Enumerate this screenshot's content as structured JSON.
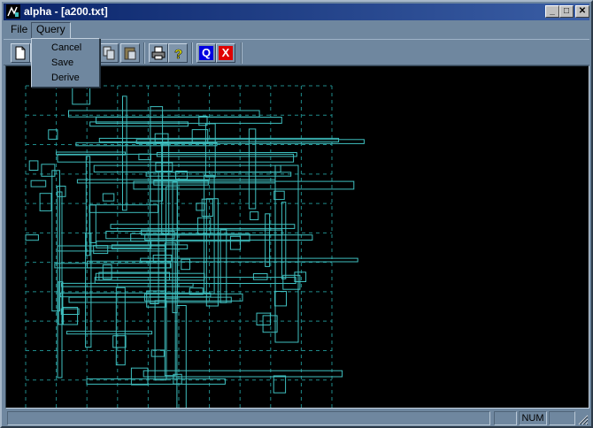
{
  "window": {
    "title": "alpha - [a200.txt]"
  },
  "title_buttons": {
    "minimize": "_",
    "maximize": "□",
    "close": "✕"
  },
  "menu": {
    "file": "File",
    "query": "Query"
  },
  "query_menu": {
    "items": [
      "Cancel",
      "Save",
      "Derive"
    ]
  },
  "toolbar": {
    "buttons": [
      "new-icon",
      "open-icon",
      "save-icon",
      "cut-icon",
      "copy-icon",
      "paste-icon",
      "print-icon",
      "help-icon",
      "query-icon",
      "close-query-icon"
    ],
    "query_letter": "Q",
    "close_letter": "X"
  },
  "status": {
    "num": "NUM"
  },
  "colors": {
    "wire": "#3fbfbf",
    "grid": "#1f8a8a",
    "canvas": "#000000",
    "frame": "#6f879f",
    "titlebar": "#0a246a"
  }
}
